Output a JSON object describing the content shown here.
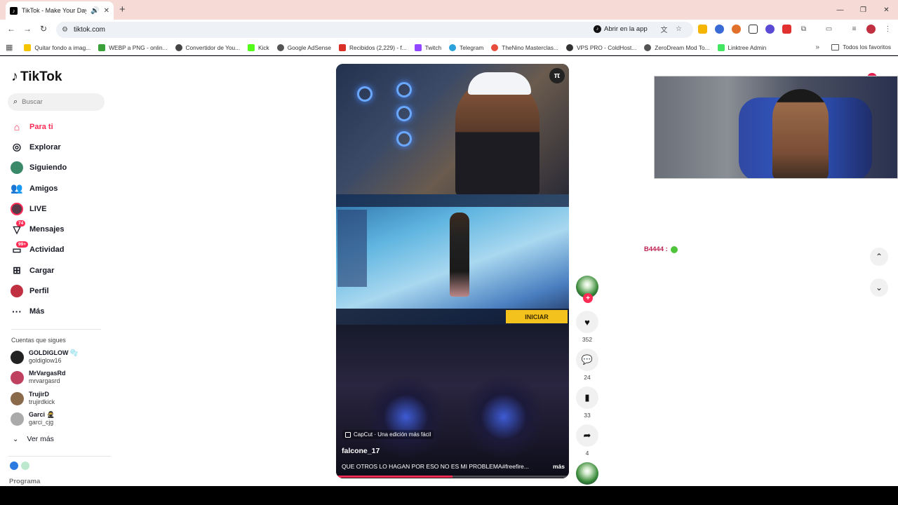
{
  "browser": {
    "tab_title": "TikTok - Make Your Day",
    "url": "tiktok.com",
    "open_in_app": "Abrir en la app",
    "bookmarks": [
      {
        "label": "Quitar fondo a imag...",
        "color": "#f5c400"
      },
      {
        "label": "WEBP a PNG - onlin...",
        "color": "#3aa13a"
      },
      {
        "label": "Convertidor de You...",
        "color": "#444444"
      },
      {
        "label": "Kick",
        "color": "#53fc18"
      },
      {
        "label": "Google AdSense",
        "color": "#555555"
      },
      {
        "label": "Recibidos (2,229) - f...",
        "color": "#d93025"
      },
      {
        "label": "Twitch",
        "color": "#9146ff"
      },
      {
        "label": "Telegram",
        "color": "#2aa1da"
      },
      {
        "label": "TheNino Masterclas...",
        "color": "#e74c3c"
      },
      {
        "label": "VPS PRO - ColdHost...",
        "color": "#333333"
      },
      {
        "label": "ZeroDream Mod To...",
        "color": "#555555"
      },
      {
        "label": "Linktree Admin",
        "color": "#43e660"
      }
    ],
    "all_bookmarks": "Todos los favoritos"
  },
  "sidebar": {
    "logo": "TikTok",
    "search_placeholder": "Buscar",
    "nav": [
      {
        "label": "Para ti",
        "icon": "home-icon",
        "active": true
      },
      {
        "label": "Explorar",
        "icon": "compass-icon"
      },
      {
        "label": "Siguiendo",
        "icon": "following-avatar-icon"
      },
      {
        "label": "Amigos",
        "icon": "friends-icon"
      },
      {
        "label": "LIVE",
        "icon": "live-icon"
      },
      {
        "label": "Mensajes",
        "icon": "message-icon",
        "badge": "74"
      },
      {
        "label": "Actividad",
        "icon": "activity-icon",
        "badge": "99+"
      },
      {
        "label": "Cargar",
        "icon": "upload-icon"
      },
      {
        "label": "Perfil",
        "icon": "profile-icon"
      },
      {
        "label": "Más",
        "icon": "more-icon"
      }
    ],
    "following_title": "Cuentas que sigues",
    "accounts": [
      {
        "name": "GOLDIGLOW 🫧",
        "handle": "goldiglow16",
        "color": "#222222"
      },
      {
        "name": "MrVargasRd",
        "handle": "mrvargasrd",
        "color": "#c04060"
      },
      {
        "name": "TrujirD",
        "handle": "trujirdkick",
        "color": "#8a6a4a"
      },
      {
        "name": "Garci 🥷",
        "handle": "garci_cjg",
        "color": "#aaaaaa"
      }
    ],
    "see_more": "Ver más",
    "program": "Programa"
  },
  "video": {
    "capcut_label": "CapCut · Una edición más fácil",
    "author": "falcone_17",
    "description": "QUE  OTROS LO HAGAN POR ESO NO ES MI PROBLEMA#freefire...",
    "more": "más",
    "game_button": "INICIAR",
    "progress": 0.5,
    "likes": "352",
    "comments": "24",
    "saves": "33",
    "shares": "4"
  },
  "chat": {
    "username": "B4444 :"
  }
}
